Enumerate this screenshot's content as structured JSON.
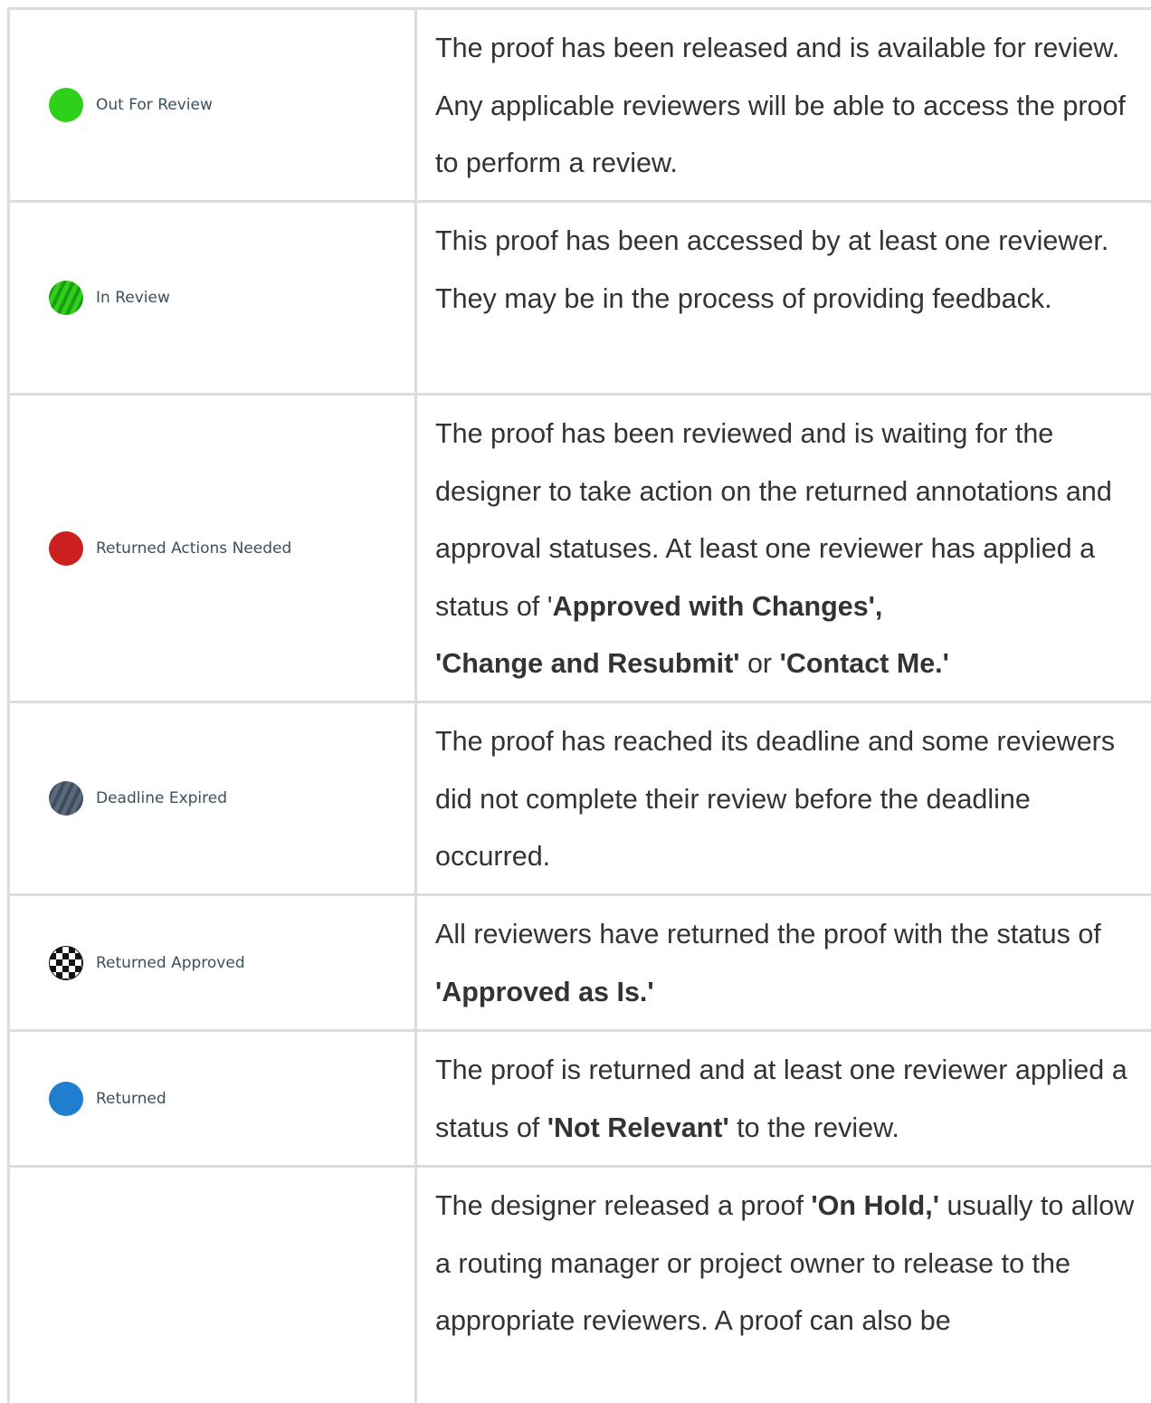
{
  "rows": [
    {
      "label": "Out For Review",
      "icon": "solid-green-dot-icon",
      "color": "#2fd01a",
      "desc": "The proof has been released and is available for review.  Any applicable reviewers will be able to access the proof to perform a review."
    },
    {
      "label": "In Review",
      "icon": "striped-green-dot-icon",
      "color": "#2fd01a",
      "desc": "This proof has been accessed by at least one reviewer.  They may be in the process of providing feedback."
    },
    {
      "label": "Returned Actions Needed",
      "icon": "solid-red-dot-icon",
      "color": "#cc2020",
      "desc_a": "The proof has been reviewed and is waiting for the designer to take action on the returned annotations and approval statuses. At least one reviewer has applied a status of '",
      "desc_b1": "Approved with Changes',",
      "desc_b2": "'Change and Resubmit'",
      "desc_c": " or ",
      "desc_b3": "'Contact Me.'"
    },
    {
      "label": "Deadline Expired",
      "icon": "striped-slate-dot-icon",
      "color": "#5a6a7c",
      "desc": "The proof has reached its deadline and some reviewers did not complete their review before the deadline occurred."
    },
    {
      "label": "Returned Approved",
      "icon": "checkered-flag-icon",
      "desc_a": "All reviewers have returned the proof with the status of ",
      "desc_b": "'Approved as Is.'"
    },
    {
      "label": "Returned",
      "icon": "solid-blue-dot-icon",
      "color": "#1f7fce",
      "desc_a": "The proof is returned and at least one reviewer applied a status of ",
      "desc_b": "'Not Relevant'",
      "desc_c": " to the review."
    },
    {
      "label": "",
      "desc_a": "The designer released a proof ",
      "desc_b": "'On Hold,'",
      "desc_c": " usually to allow a routing manager or project owner to release to the appropriate reviewers.  A proof can also be"
    }
  ]
}
